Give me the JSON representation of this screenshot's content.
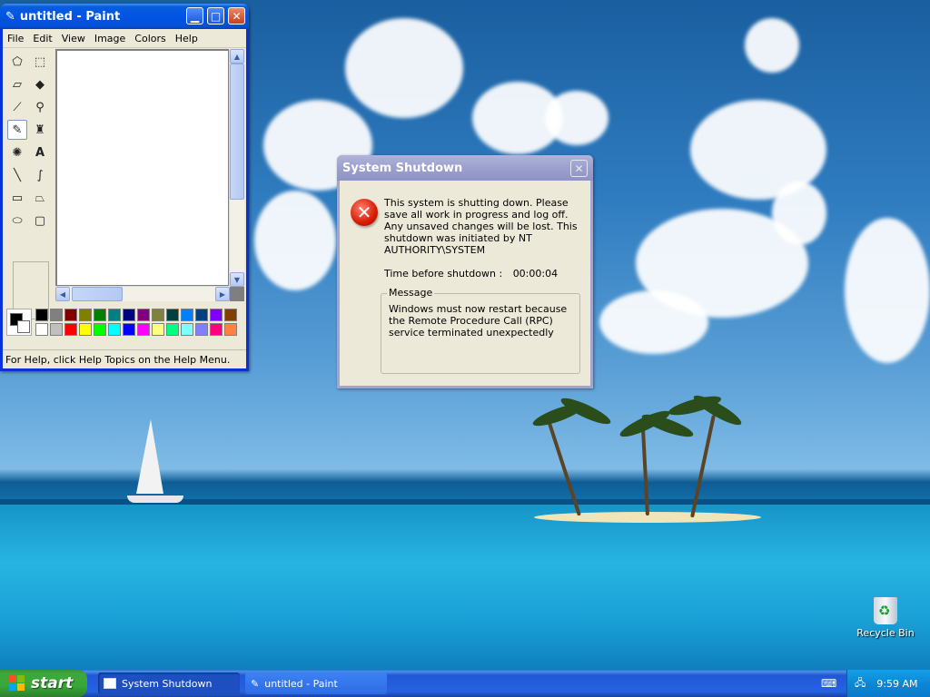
{
  "paint": {
    "title": "untitled - Paint",
    "menu": [
      "File",
      "Edit",
      "View",
      "Image",
      "Colors",
      "Help"
    ],
    "status": "For Help, click Help Topics on the Help Menu."
  },
  "dialog": {
    "title": "System Shutdown",
    "message": "This system is shutting down. Please save all work in progress and log off. Any unsaved changes will be lost. This shutdown was initiated by NT AUTHORITY\\SYSTEM",
    "time_label": "Time before shutdown :",
    "time_value": "00:00:04",
    "group_label": "Message",
    "group_text": "Windows must now restart because the Remote Procedure Call (RPC) service terminated unexpectedly"
  },
  "desktop": {
    "recycle_bin": "Recycle Bin"
  },
  "taskbar": {
    "start": "start",
    "tasks": [
      "System Shutdown",
      "untitled - Paint"
    ],
    "clock": "9:59 AM"
  },
  "palette_colors": [
    "#000000",
    "#808080",
    "#800000",
    "#808000",
    "#008000",
    "#008080",
    "#000080",
    "#800080",
    "#808040",
    "#004040",
    "#0080ff",
    "#004080",
    "#8000ff",
    "#804000",
    "#ffffff",
    "#c0c0c0",
    "#ff0000",
    "#ffff00",
    "#00ff00",
    "#00ffff",
    "#0000ff",
    "#ff00ff",
    "#ffff80",
    "#00ff80",
    "#80ffff",
    "#8080ff",
    "#ff0080",
    "#ff8040"
  ]
}
